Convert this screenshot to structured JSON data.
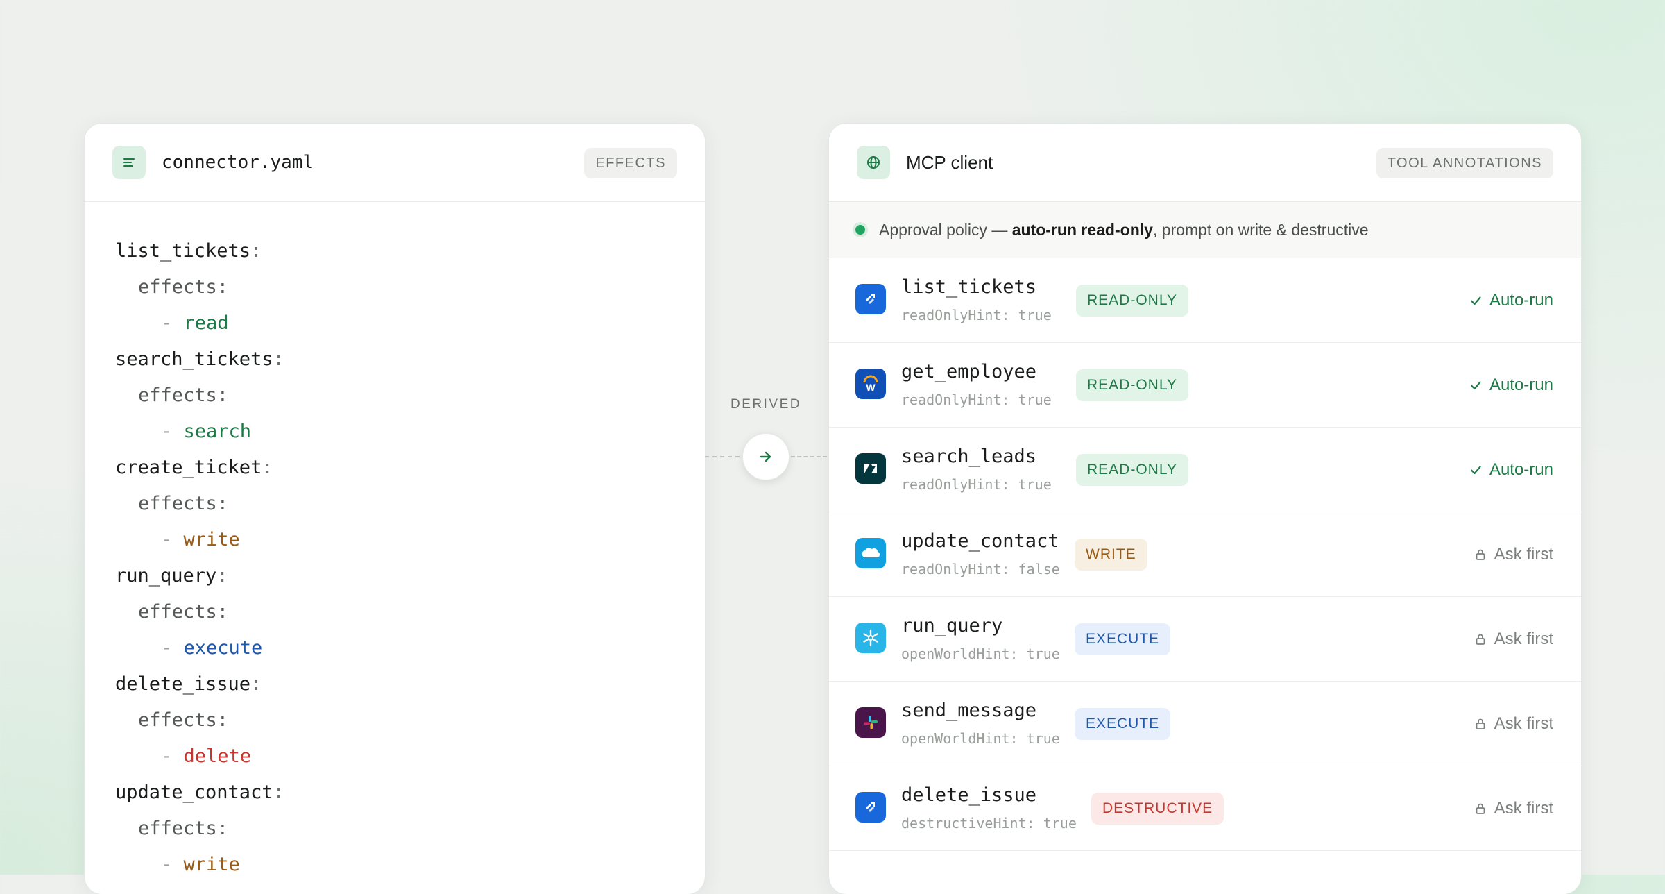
{
  "left_panel": {
    "title": "connector.yaml",
    "chip": "EFFECTS",
    "icon": "file-lines-icon",
    "code": [
      {
        "tool": "list_tickets",
        "effect": "read"
      },
      {
        "tool": "search_tickets",
        "effect": "search"
      },
      {
        "tool": "create_ticket",
        "effect": "write"
      },
      {
        "tool": "run_query",
        "effect": "execute"
      },
      {
        "tool": "delete_issue",
        "effect": "delete"
      },
      {
        "tool": "update_contact",
        "effect": "write"
      }
    ],
    "effects_key": "effects",
    "colon": ":",
    "dash": "- "
  },
  "connector": {
    "label": "DERIVED",
    "icon": "arrow-right-icon"
  },
  "right_panel": {
    "title": "MCP client",
    "chip": "TOOL ANNOTATIONS",
    "icon": "globe-icon",
    "policy": {
      "prefix": "Approval policy — ",
      "bold": "auto-run read-only",
      "suffix": ", prompt on write & destructive",
      "status_color": "#1fa55f"
    },
    "tools": [
      {
        "name": "list_tickets",
        "hint": "readOnlyHint: true",
        "badge": "READ-ONLY",
        "badge_type": "read",
        "action": "Auto-run",
        "action_type": "auto",
        "app_icon": "jira-icon"
      },
      {
        "name": "get_employee",
        "hint": "readOnlyHint: true",
        "badge": "READ-ONLY",
        "badge_type": "read",
        "action": "Auto-run",
        "action_type": "auto",
        "app_icon": "workday-icon"
      },
      {
        "name": "search_leads",
        "hint": "readOnlyHint: true",
        "badge": "READ-ONLY",
        "badge_type": "read",
        "action": "Auto-run",
        "action_type": "auto",
        "app_icon": "zendesk-icon"
      },
      {
        "name": "update_contact",
        "hint": "readOnlyHint: false",
        "badge": "WRITE",
        "badge_type": "write",
        "action": "Ask first",
        "action_type": "ask",
        "app_icon": "salesforce-icon"
      },
      {
        "name": "run_query",
        "hint": "openWorldHint: true",
        "badge": "EXECUTE",
        "badge_type": "execute",
        "action": "Ask first",
        "action_type": "ask",
        "app_icon": "snowflake-icon"
      },
      {
        "name": "send_message",
        "hint": "openWorldHint: true",
        "badge": "EXECUTE",
        "badge_type": "execute",
        "action": "Ask first",
        "action_type": "ask",
        "app_icon": "slack-icon"
      },
      {
        "name": "delete_issue",
        "hint": "destructiveHint: true",
        "badge": "DESTRUCTIVE",
        "badge_type": "destructive",
        "action": "Ask first",
        "action_type": "ask",
        "app_icon": "jira-icon"
      }
    ]
  },
  "colors": {
    "read": "#1d7a47",
    "write": "#9a5a12",
    "execute": "#1f58a8",
    "destructive": "#c8352e"
  }
}
